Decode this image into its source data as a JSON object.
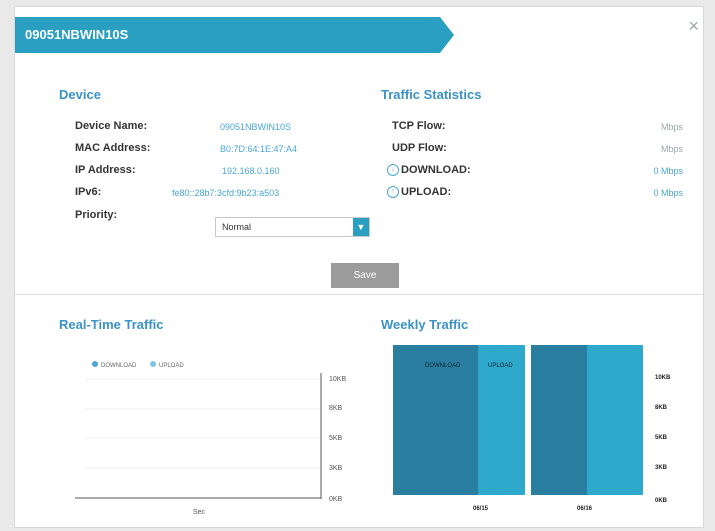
{
  "dialog": {
    "title": "09051NBWIN10S",
    "close_glyph": "×"
  },
  "device": {
    "heading": "Device",
    "name_label": "Device Name:",
    "name_value": "09051NBWIN10S",
    "mac_label": "MAC Address:",
    "mac_value": "B0:7D:64:1E:47:A4",
    "ip_label": "IP Address:",
    "ip_value": "192.168.0.160",
    "ipv6_label": "IPv6:",
    "ipv6_value": "fe80::28b7:3cfd:9b23:a503",
    "priority_label": "Priority:",
    "priority_value": "Normal"
  },
  "traffic": {
    "heading": "Traffic Statistics",
    "tcp_label": "TCP Flow:",
    "tcp_value": "Mbps",
    "udp_label": "UDP Flow:",
    "udp_value": "Mbps",
    "download_label": "DOWNLOAD:",
    "download_value": "0 Mbps",
    "upload_label": "UPLOAD:",
    "upload_value": "0 Mbps"
  },
  "save_label": "Save",
  "realtime": {
    "heading": "Real-Time Traffic",
    "legend": [
      "DOWNLOAD",
      "UPLOAD"
    ],
    "y_ticks": [
      "10KB",
      "8KB",
      "5KB",
      "3KB",
      "0KB"
    ],
    "x_label": "Sec"
  },
  "weekly": {
    "heading": "Weekly Traffic",
    "legend": [
      "DOWNLOAD",
      "UPLOAD"
    ],
    "y_ticks": [
      "10KB",
      "8KB",
      "5KB",
      "3KB",
      "0KB"
    ],
    "dates": [
      "06/15",
      "06/16"
    ]
  },
  "colors": {
    "accent": "#2a9fc2",
    "download": "#2a7fa0",
    "upload": "#2ea8cb"
  }
}
